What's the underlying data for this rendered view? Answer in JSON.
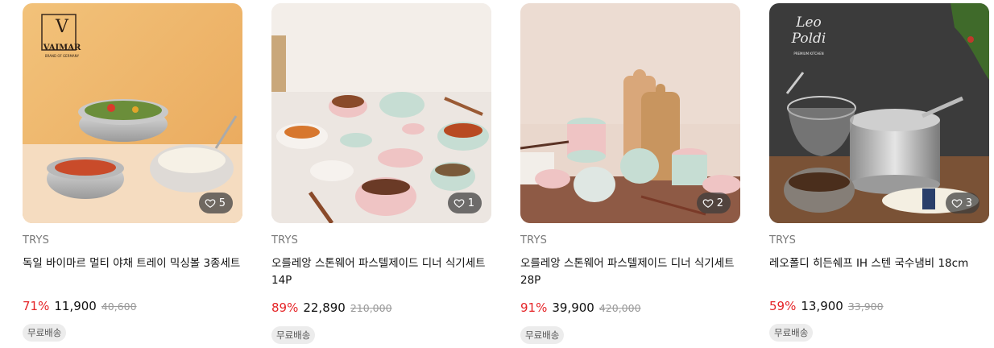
{
  "products": [
    {
      "brand": "TRYS",
      "title": "독일 바이마르 멀티 야채 트레이 믹싱볼 3종세트",
      "discount": "71%",
      "price": "11,900",
      "original_price": "40,600",
      "likes": "5",
      "shipping": "무료배송",
      "logo": {
        "main": "VAIMAR",
        "sub": "BRAND OF GERMANY",
        "mark": "V"
      },
      "image": "stainless-mixing-bowls-with-salad-and-noodles"
    },
    {
      "brand": "TRYS",
      "title": "오를레앙 스톤웨어 파스텔제이드 디너 식기세트 14P",
      "discount": "89%",
      "price": "22,890",
      "original_price": "210,000",
      "likes": "1",
      "shipping": "무료배송",
      "image": "pastel-stoneware-bowls-with-korean-food"
    },
    {
      "brand": "TRYS",
      "title": "오를레앙 스톤웨어 파스텔제이드 디너 식기세트 28P",
      "discount": "91%",
      "price": "39,900",
      "original_price": "420,000",
      "likes": "2",
      "shipping": "무료배송",
      "image": "pastel-stoneware-stacked-with-cutting-boards"
    },
    {
      "brand": "TRYS",
      "title": "레오폴디 히든쉐프 IH 스텐 국수냄비 18cm",
      "discount": "59%",
      "price": "13,900",
      "original_price": "33,900",
      "likes": "3",
      "shipping": "무료배송",
      "logo": {
        "main": "Leo Poldi",
        "sub": "PREMIUM KITCHEN"
      },
      "image": "stainless-noodle-pot-with-strainer"
    }
  ],
  "colors": {
    "discount": "#e52528",
    "badge_bg": "#ececec",
    "like_bg": "#3c3c3c"
  }
}
